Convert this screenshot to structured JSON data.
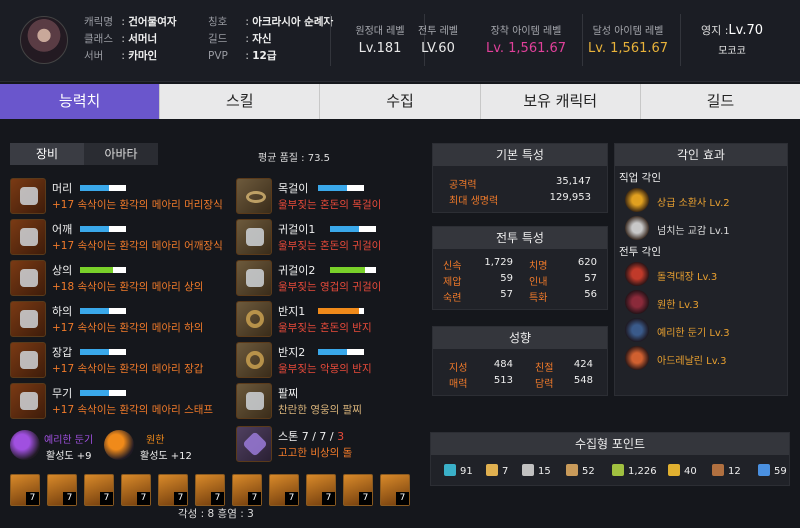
{
  "profile": {
    "fields": [
      {
        "key": "캐릭명",
        "value": "건어물여자"
      },
      {
        "key": "클래스",
        "value": "서머너"
      },
      {
        "key": "서버",
        "value": "카마인"
      }
    ],
    "fields2": [
      {
        "key": "칭호",
        "value": "아크라시아 순례자"
      },
      {
        "key": "길드",
        "value": "자신"
      },
      {
        "key": "PVP",
        "value": "12급"
      }
    ]
  },
  "stats": [
    {
      "label": "원정대 레벨",
      "value": "Lv.181",
      "color": "#e8e8e8"
    },
    {
      "label": "전투 레벨",
      "value": "LV.60",
      "color": "#e8e8e8"
    },
    {
      "label": "장착 아이템 레벨",
      "value": "Lv. 1,561.67",
      "color": "#e0409a"
    },
    {
      "label": "달성 아이템 레벨",
      "value": "Lv. 1,561.67",
      "color": "#e8b23a"
    }
  ],
  "territory": {
    "label": "영지 :",
    "level": "Lv.70",
    "name": "모코코"
  },
  "tabs": [
    "능력치",
    "스킬",
    "수집",
    "보유 캐릭터",
    "길드"
  ],
  "subtabs": [
    "장비",
    "아바타"
  ],
  "avg_quality": "평균 품질 : 73.5",
  "equipment_left": [
    {
      "name": "머리",
      "sub": "+17 속삭이는 환각의 메아리 머리장식",
      "quality": 0.62,
      "bar": "#3aa8ea"
    },
    {
      "name": "어깨",
      "sub": "+17 속삭이는 환각의 메아리 어깨장식",
      "quality": 0.62,
      "bar": "#3aa8ea"
    },
    {
      "name": "상의",
      "sub": "+18 속삭이는 환각의 메아리 상의",
      "quality": 0.72,
      "bar": "#7ad12a"
    },
    {
      "name": "하의",
      "sub": "+17 속삭이는 환각의 메아리 하의",
      "quality": 0.62,
      "bar": "#3aa8ea"
    },
    {
      "name": "장갑",
      "sub": "+17 속삭이는 환각의 메아리 장갑",
      "quality": 0.62,
      "bar": "#3aa8ea"
    },
    {
      "name": "무기",
      "sub": "+17 속삭이는 환각의 메아리 스태프",
      "quality": 0.62,
      "bar": "#3aa8ea"
    }
  ],
  "equipment_right": [
    {
      "name": "목걸이",
      "sub": "울부짖는 혼돈의 목걸이",
      "quality": 0.62,
      "bar": "#3aa8ea"
    },
    {
      "name": "귀걸이1",
      "sub": "울부짖는 혼돈의 귀걸이",
      "quality": 0.62,
      "bar": "#3aa8ea"
    },
    {
      "name": "귀걸이2",
      "sub": "울부짖는 영겁의 귀걸이",
      "quality": 0.75,
      "bar": "#7ad12a"
    },
    {
      "name": "반지1",
      "sub": "울부짖는 혼돈의 반지",
      "quality": 0.9,
      "bar": "#f08a1a"
    },
    {
      "name": "반지2",
      "sub": "울부짖는 악몽의 반지",
      "quality": 0.62,
      "bar": "#3aa8ea"
    },
    {
      "name": "팔찌",
      "sub": "찬란한 영웅의 팔찌",
      "quality": null,
      "bar": ""
    }
  ],
  "stone": {
    "prefix": "스톤 7 / 7 / ",
    "last": "3",
    "sub": "고고한 비상의 돌"
  },
  "gems": [
    {
      "name": "예리한 둔기",
      "level": "활성도 +9",
      "color": "#a050e0"
    },
    {
      "name": "원한",
      "level": "활성도 +12",
      "color": "#f08a1a"
    }
  ],
  "cards": [
    "7",
    "7",
    "7",
    "7",
    "7",
    "7",
    "7",
    "7",
    "7",
    "7",
    "7"
  ],
  "awakening": "각성 : 8  흥염 : 3",
  "basic": {
    "title": "기본 특성",
    "rows": [
      {
        "k": "공격력",
        "v": "35,147"
      },
      {
        "k": "최대 생명력",
        "v": "129,953"
      }
    ]
  },
  "combat": {
    "title": "전투 특성",
    "rows": [
      {
        "k1": "신속",
        "v1": "1,729",
        "k2": "치명",
        "v2": "620"
      },
      {
        "k1": "제압",
        "v1": "59",
        "k2": "인내",
        "v2": "57"
      },
      {
        "k1": "숙련",
        "v1": "57",
        "k2": "특화",
        "v2": "56"
      }
    ]
  },
  "tendency": {
    "title": "성향",
    "rows": [
      {
        "k1": "지성",
        "v1": "484",
        "k2": "친절",
        "v2": "424"
      },
      {
        "k1": "매력",
        "v1": "513",
        "k2": "담력",
        "v2": "548"
      }
    ]
  },
  "engravings": {
    "title": "각인 효과",
    "class_label": "직업 각인",
    "class": [
      {
        "name": "상급 소환사 Lv.2",
        "color": "#e0a020"
      },
      {
        "name": "넘치는 교감 Lv.1",
        "color": "#c8c8c8"
      }
    ],
    "combat_label": "전투 각인",
    "combat": [
      {
        "name": "돌격대장 Lv.3",
        "color": "#c03a2a"
      },
      {
        "name": "원한 Lv.3",
        "color": "#8a2a3a"
      },
      {
        "name": "예리한 둔기 Lv.3",
        "color": "#3a5a8a"
      },
      {
        "name": "아드레날린 Lv.3",
        "color": "#d06030"
      }
    ]
  },
  "collection": {
    "title": "수집형 포인트",
    "items": [
      {
        "icon": "island-heart-icon",
        "value": "91",
        "color": "#3ab0c8"
      },
      {
        "icon": "star-seed-icon",
        "value": "7",
        "color": "#e0b050"
      },
      {
        "icon": "mokoko-seed-icon",
        "value": "15",
        "color": "#c0c0c0"
      },
      {
        "icon": "art-icon",
        "value": "52",
        "color": "#c89a5a"
      },
      {
        "icon": "leaf-icon",
        "value": "1,226",
        "color": "#a0c040"
      },
      {
        "icon": "adventure-icon",
        "value": "40",
        "color": "#e0b030"
      },
      {
        "icon": "ignea-icon",
        "value": "12",
        "color": "#b07040"
      },
      {
        "icon": "world-tree-leaf-icon",
        "value": "59",
        "color": "#4a90e0"
      }
    ]
  }
}
